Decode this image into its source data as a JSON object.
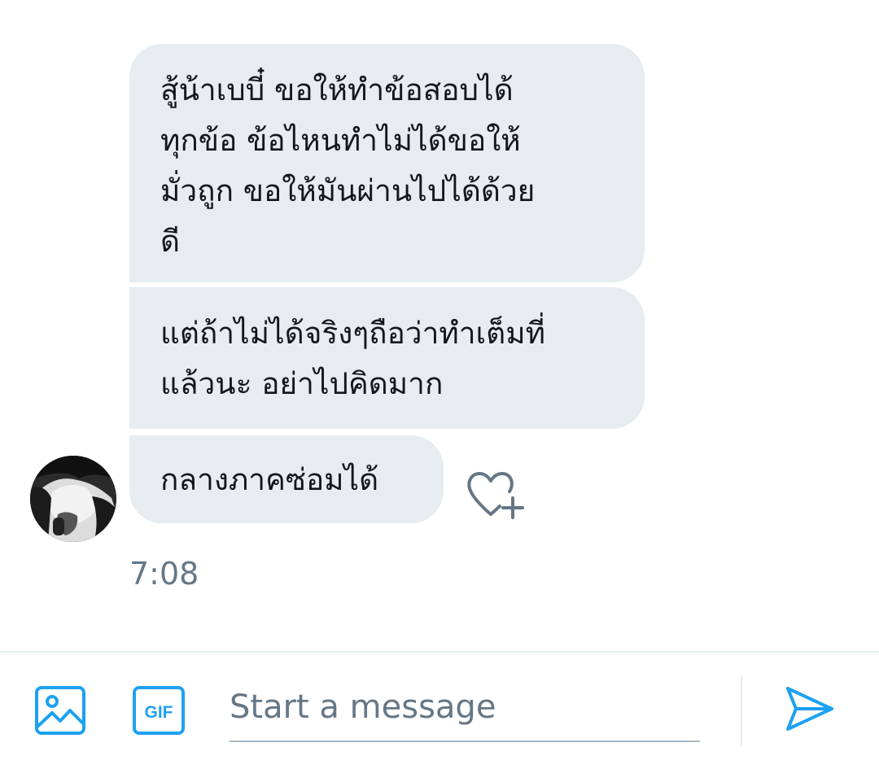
{
  "conversation": {
    "messages": [
      {
        "text": "สู้น้าเบบี๋ ขอให้ทำข้อสอบได้\nทุกข้อ ข้อไหนทำไม่ได้ขอให้\nมั่วถูก ขอให้มันผ่านไปได้ด้วย\nดี"
      },
      {
        "text": "แต่ถ้าไม่ได้จริงๆถือว่าทำเต็มที่\nแล้วนะ อย่าไปคิดมาก"
      },
      {
        "text": "กลางภาคซ่อมได้"
      }
    ],
    "timestamp": "7:08"
  },
  "composer": {
    "placeholder": "Start a message",
    "value": "",
    "gif_label": "GIF"
  },
  "icons": {
    "heart_add": "heart-plus-icon",
    "image": "image-icon",
    "gif": "gif-icon",
    "send": "send-icon"
  },
  "colors": {
    "accent": "#1da1f2",
    "bubble_bg": "#e6ecf0",
    "text": "#14171a",
    "secondary_text": "#657786"
  }
}
